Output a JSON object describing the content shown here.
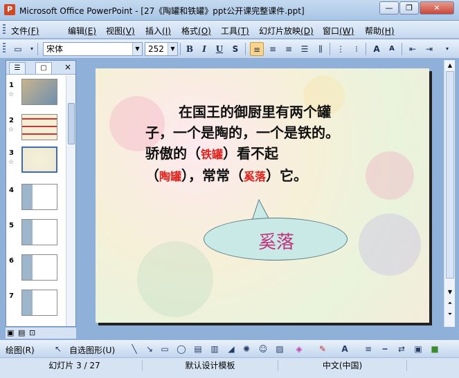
{
  "window": {
    "title": "Microsoft Office PowerPoint - [27《陶罐和铁罐》ppt公开课完整课件.ppt]",
    "minimize": "—",
    "restore": "❐",
    "close": "✕"
  },
  "menu": {
    "items": [
      {
        "label": "文件",
        "key": "(F)"
      },
      {
        "label": "编辑",
        "key": "(E)"
      },
      {
        "label": "视图",
        "key": "(V)"
      },
      {
        "label": "插入",
        "key": "(I)"
      },
      {
        "label": "格式",
        "key": "(O)"
      },
      {
        "label": "工具",
        "key": "(T)"
      },
      {
        "label": "幻灯片放映",
        "key": "(D)"
      },
      {
        "label": "窗口",
        "key": "(W)"
      },
      {
        "label": "帮助",
        "key": "(H)"
      }
    ]
  },
  "toolbar": {
    "font_name": "宋体",
    "font_size": "252",
    "bold": "B",
    "italic": "I",
    "underline": "U",
    "shadow": "S"
  },
  "pane": {
    "close": "×",
    "slides": [
      {
        "num": "1",
        "star": "☆"
      },
      {
        "num": "2",
        "star": "☆"
      },
      {
        "num": "3",
        "star": "☆"
      },
      {
        "num": "4",
        "star": ""
      },
      {
        "num": "5",
        "star": ""
      },
      {
        "num": "6",
        "star": ""
      },
      {
        "num": "7",
        "star": ""
      }
    ]
  },
  "slide": {
    "line1": "在国王的御厨里有两个罐",
    "line2": "子，一个是陶的，一个是铁的。",
    "line3_pre": "骄傲的（",
    "line3_red": "铁罐",
    "line3_post": "）看不起",
    "line4_pre": "（",
    "line4_red": "陶罐",
    "line4_mid": "），常常（",
    "line4_red2": "奚落",
    "line4_post": "）它。",
    "callout": "奚落"
  },
  "drawbar": {
    "draw": "绘图(R)",
    "autoshapes": "自选图形(U)"
  },
  "status": {
    "slide": "幻灯片 3 / 27",
    "template": "默认设计模板",
    "language": "中文(中国)"
  },
  "colors": {
    "accent_red": "#e0201a",
    "callout_fill": "#c9e9e6",
    "callout_text": "#c0307a"
  }
}
